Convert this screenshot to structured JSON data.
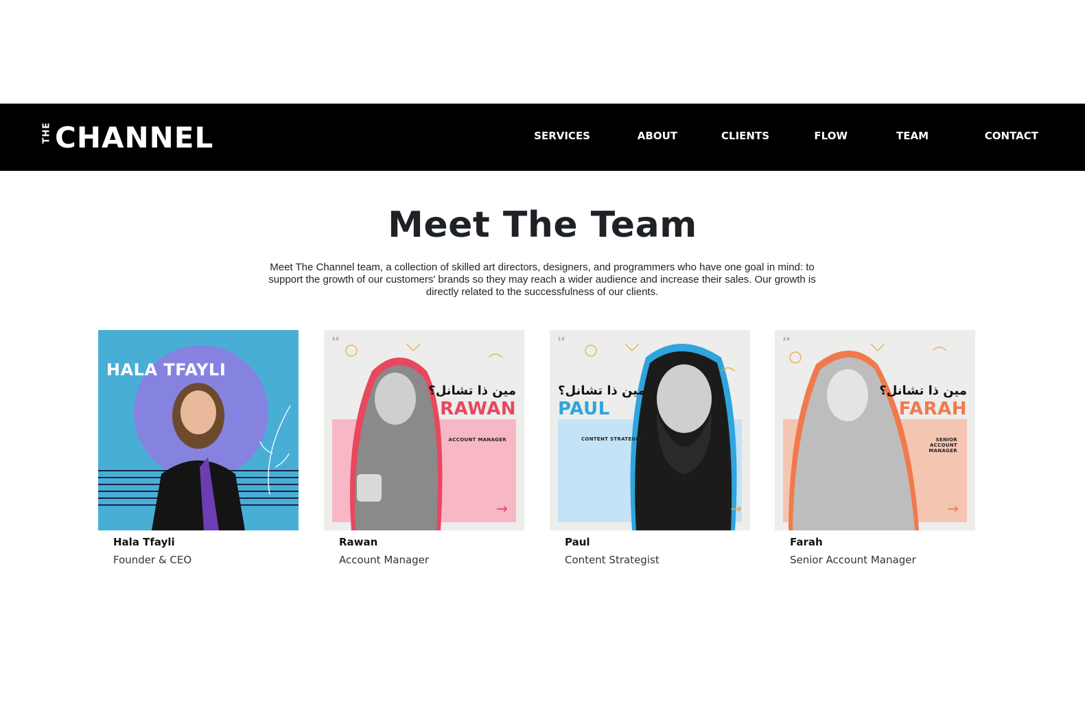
{
  "brand": {
    "logo_small": "THE",
    "logo_main": "CHANNEL"
  },
  "nav": {
    "items": [
      "SERVICES",
      "ABOUT",
      "CLIENTS",
      "FLOW",
      "TEAM",
      "CONTACT"
    ]
  },
  "section": {
    "title": "Meet The Team",
    "description": "Meet The Channel team, a collection of skilled art directors, designers, and programmers who have one goal in mind: to support the growth of our customers' brands so they may reach a wider audience and increase their sales. Our growth is directly related to the successfulness of our clients."
  },
  "team": [
    {
      "name": "Hala Tfayli",
      "role": "Founder & CEO",
      "photo_text": "HALA TFAYLI",
      "photo_arabic": "",
      "photo_role": "",
      "photo_num": "",
      "accent": "#3aa6d4"
    },
    {
      "name": "Rawan",
      "role": "Account Manager",
      "photo_text": "RAWAN",
      "photo_arabic": "مين ذا تشانل؟",
      "photo_role": "ACCOUNT MANAGER",
      "photo_num": "3.0",
      "accent": "#e8475f"
    },
    {
      "name": "Paul",
      "role": "Content Strategist",
      "photo_text": "PAUL",
      "photo_arabic": "مين ذا تشانل؟",
      "photo_role": "CONTENT STRATEGIST",
      "photo_num": "1.0",
      "accent": "#2fa4de"
    },
    {
      "name": "Farah",
      "role": "Senior Account Manager",
      "photo_text": "FARAH",
      "photo_arabic": "مين ذا تشانل؟",
      "photo_role": "SENIOR ACCOUNT MANAGER",
      "photo_num": "2.0",
      "accent": "#f07a4d"
    }
  ]
}
